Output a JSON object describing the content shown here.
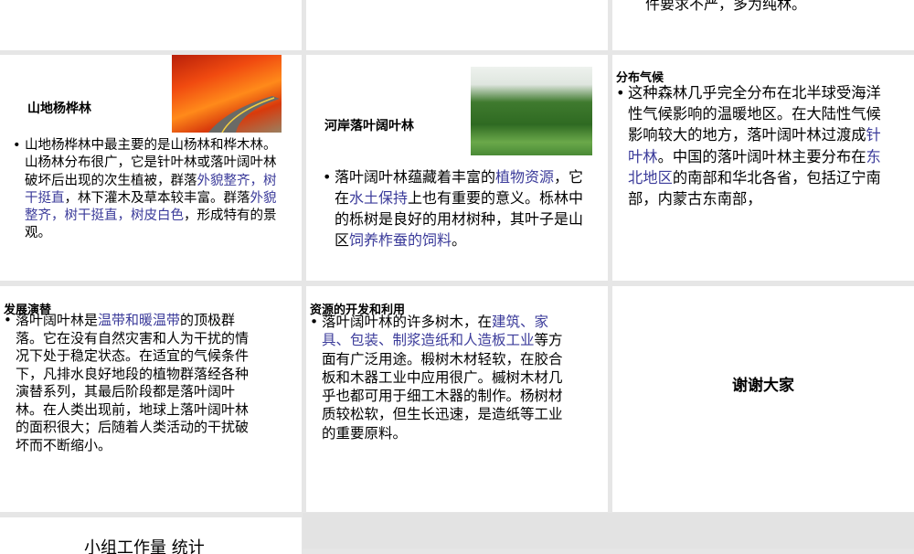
{
  "slides": {
    "top_right_fragment": "件要求不严，多为纯林。",
    "mountain": {
      "title": "山地杨桦林",
      "image": "autumn-red-forest-road-photo",
      "segments": [
        {
          "t": "山地杨桦林中最主要的是山杨林和桦木林。山杨林分布很广，它是针叶林或落叶阔叶林破坏后出现的次生植被，群落"
        },
        {
          "t": "外貌整齐，树干挺直",
          "hl": true
        },
        {
          "t": "，林下灌木及草本较丰富。群落"
        },
        {
          "t": "外貌整齐，树干挺直，树皮白色",
          "hl": true
        },
        {
          "t": "，形成特有的景观。"
        }
      ]
    },
    "riverbank": {
      "title": "河岸落叶阔叶林",
      "image": "green-river-valley-forest-photo",
      "segments": [
        {
          "t": "落叶阔叶林蕴藏着丰富的"
        },
        {
          "t": "植物资源",
          "hl": true
        },
        {
          "t": "，它在"
        },
        {
          "t": "水土保持",
          "hl": true
        },
        {
          "t": "上也有重要的意义。栎林中的栎树是良好的用材树种，其叶子是山区"
        },
        {
          "t": "饲养柞蚕的饲料",
          "hl": true
        },
        {
          "t": "。"
        }
      ]
    },
    "climate": {
      "title": "分布气候",
      "segments": [
        {
          "t": "这种森林几乎完全分布在北半球受海洋性气候影响的温暖地区。在大陆性气候影响较大的地方，落叶阔叶林过渡成"
        },
        {
          "t": "针叶林",
          "hl": true
        },
        {
          "t": "。中国的落叶阔叶林主要分布在"
        },
        {
          "t": "东北地区",
          "hl": true
        },
        {
          "t": "的南部和华北各省，包括辽宁南部，内蒙古东南部，"
        }
      ]
    },
    "succession": {
      "title": "发展演替",
      "segments": [
        {
          "t": "落叶阔叶林是"
        },
        {
          "t": "温带和暖温带",
          "hl": true
        },
        {
          "t": "的顶极群落。它在没有自然灾害和人为干扰的情况下处于稳定状态。在适宜的气候条件下，凡排水良好地段的植物群落经各种演替系列，其最后阶段都是落叶阔叶林。在人类出现前，地球上落叶阔叶林的面积很大；后随着人类活动的干扰破坏而不断缩小。"
        }
      ]
    },
    "resources": {
      "title": "资源的开发和利用",
      "segments": [
        {
          "t": "落叶阔叶林的许多树木，在"
        },
        {
          "t": "建筑、家具、包装、制浆造纸和人造板工业",
          "hl": true
        },
        {
          "t": "等方面有广泛用途。椴树木材轻软，在胶合板和木器工业中应用很广。槭树木材几乎也都可用于细工木器的制作。杨树材质较松软，但生长迅速，是造纸等工业的重要原料。"
        }
      ]
    },
    "thanks": {
      "title": "谢谢大家"
    },
    "workload": {
      "title": "小组工作量 统计"
    }
  }
}
